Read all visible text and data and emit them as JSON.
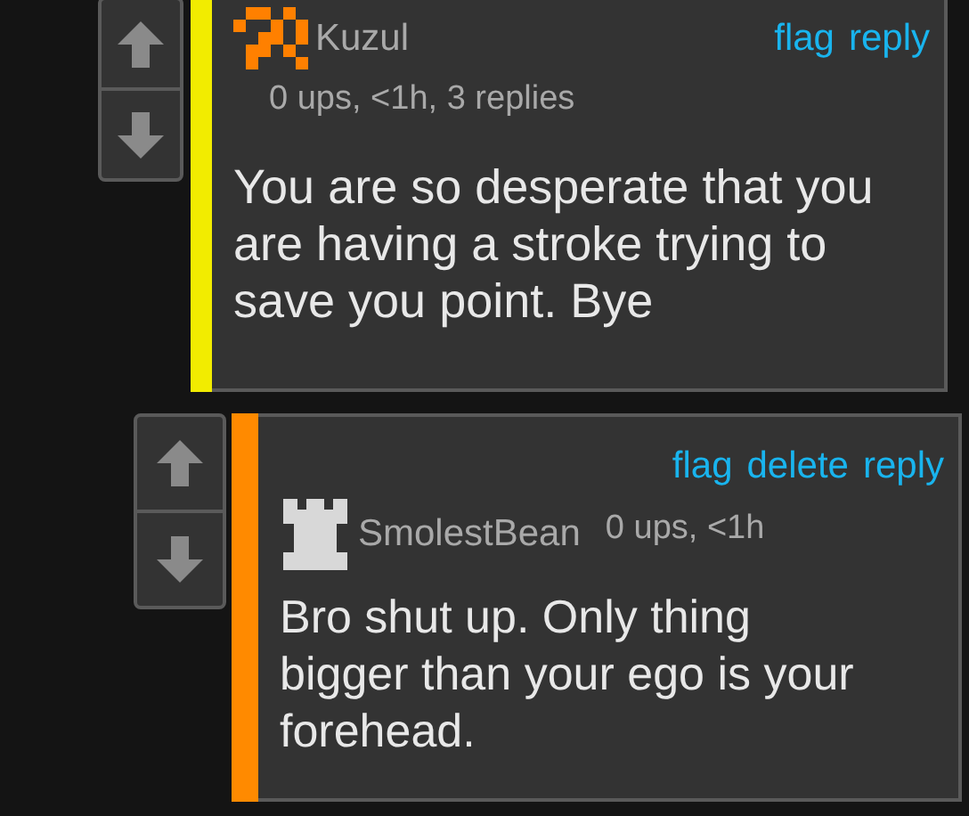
{
  "comments": [
    {
      "kind": "name-first",
      "color": "#f2ec00",
      "avatar": {
        "kind": "pixel"
      },
      "username": "Kuzul",
      "meta": "0 ups, <1h, 3 replies",
      "actions": [
        "flag",
        "reply"
      ],
      "body": "You are so desperate that you are having a stroke trying to save you point. Bye"
    },
    {
      "kind": "actions-first",
      "color": "#ff8a00",
      "avatar": {
        "kind": "tower"
      },
      "username": "SmolestBean",
      "meta": "0 ups, <1h",
      "actions": [
        "flag",
        "delete",
        "reply"
      ],
      "body": "Bro shut up. Only thing bigger than your ego is your forehead."
    }
  ]
}
